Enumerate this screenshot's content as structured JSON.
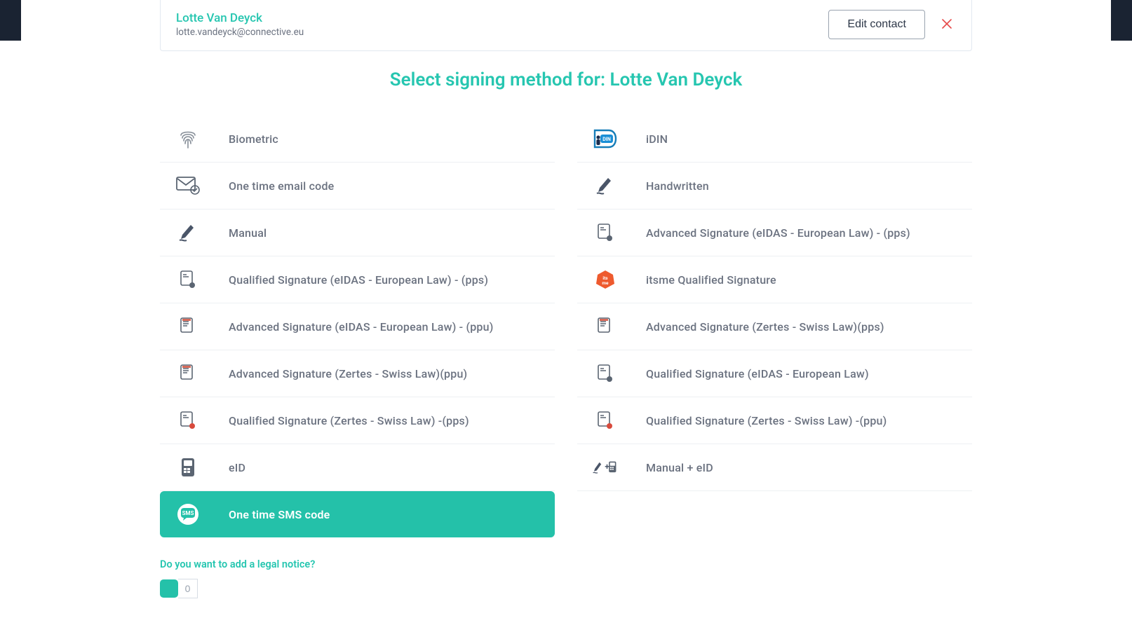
{
  "contact": {
    "name": "Lotte Van Deyck",
    "email": "lotte.vandeyck@connective.eu",
    "edit_label": "Edit contact",
    "close_label": "×"
  },
  "section_title": "Select signing method for: Lotte Van Deyck",
  "methods": {
    "left": [
      {
        "label": "Biometric",
        "icon": "fingerprint-icon",
        "selected": false
      },
      {
        "label": "One time email code",
        "icon": "email-check-icon",
        "selected": false
      },
      {
        "label": "Manual",
        "icon": "pen-icon",
        "selected": false
      },
      {
        "label": "Qualified Signature (eIDAS - European Law) - (pps)",
        "icon": "doc-badge-icon",
        "selected": false
      },
      {
        "label": "Advanced Signature (eIDAS - European Law) - (ppu)",
        "icon": "doc-line-icon",
        "selected": false
      },
      {
        "label": "Advanced Signature (Zertes - Swiss Law)(ppu)",
        "icon": "doc-line-icon",
        "selected": false
      },
      {
        "label": "Qualified Signature (Zertes - Swiss Law) -(pps)",
        "icon": "doc-red-icon",
        "selected": false
      },
      {
        "label": "eID",
        "icon": "card-reader-icon",
        "selected": false
      },
      {
        "label": "One time SMS code",
        "icon": "sms-icon",
        "selected": true
      }
    ],
    "right": [
      {
        "label": "iDIN",
        "icon": "idin-icon",
        "selected": false
      },
      {
        "label": "Handwritten",
        "icon": "pen-icon",
        "selected": false
      },
      {
        "label": "Advanced Signature (eIDAS - European Law) - (pps)",
        "icon": "doc-badge-icon",
        "selected": false
      },
      {
        "label": "itsme Qualified Signature",
        "icon": "itsme-icon",
        "selected": false
      },
      {
        "label": "Advanced Signature (Zertes - Swiss Law)(pps)",
        "icon": "doc-line-icon",
        "selected": false
      },
      {
        "label": "Qualified Signature (eIDAS - European Law)",
        "icon": "doc-badge-icon",
        "selected": false
      },
      {
        "label": "Qualified Signature (Zertes - Swiss Law) -(ppu)",
        "icon": "doc-red-icon",
        "selected": false
      },
      {
        "label": "Manual + eID",
        "icon": "pen-plus-reader-icon",
        "selected": false
      }
    ]
  },
  "legal": {
    "question": "Do you want to add a legal notice?",
    "input_value": "0"
  },
  "colors": {
    "accent": "#24c1a9",
    "accent_text": "#26c6b0",
    "danger": "#e64a4a",
    "idin_blue": "#1a8fd6",
    "itsme_orange": "#ee5a2e"
  }
}
